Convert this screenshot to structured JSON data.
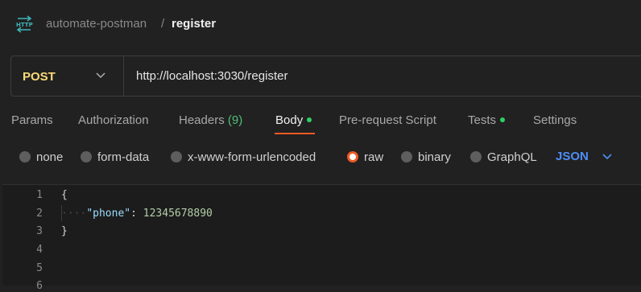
{
  "header": {
    "icon": "http-request-icon",
    "collection": "automate-postman",
    "separator": "/",
    "request_name": "register"
  },
  "request": {
    "method": "POST",
    "url": "http://localhost:3030/register"
  },
  "tabs": {
    "params": "Params",
    "authorization": "Authorization",
    "headers": "Headers",
    "headers_count": "(9)",
    "body": "Body",
    "pre_request": "Pre-request Script",
    "tests": "Tests",
    "settings": "Settings",
    "active": "Body"
  },
  "body_modes": {
    "none": "none",
    "form_data": "form-data",
    "urlencoded": "x-www-form-urlencoded",
    "raw": "raw",
    "binary": "binary",
    "graphql": "GraphQL",
    "selected": "raw",
    "language": "JSON"
  },
  "editor": {
    "line_numbers": [
      "1",
      "2",
      "3",
      "4",
      "5",
      "6"
    ],
    "line1": "{",
    "line2_indent": "····",
    "line2_key": "\"phone\"",
    "line2_colon": ": ",
    "line2_value": "12345678890",
    "line3": "}"
  },
  "colors": {
    "accent": "#ef5b25",
    "method": "#fbd97a",
    "status_dot": "#2bd067",
    "language": "#4f8ef7"
  }
}
